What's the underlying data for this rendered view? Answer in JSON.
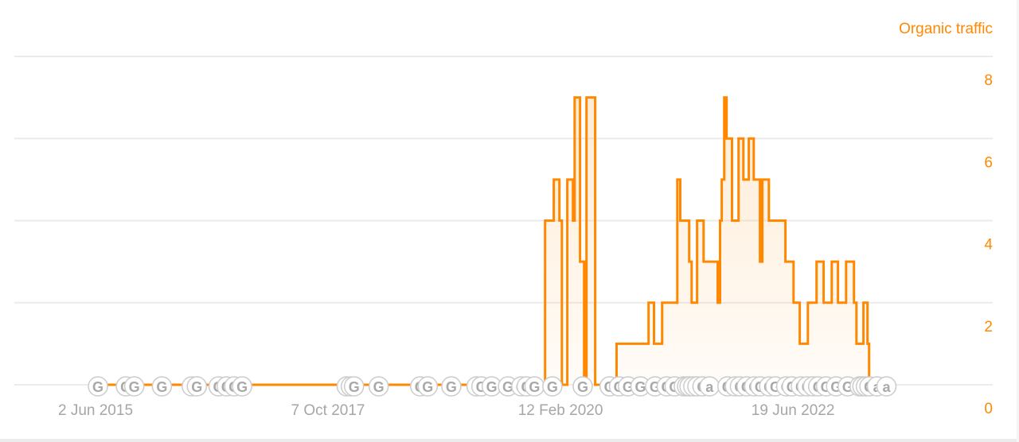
{
  "chart_data": {
    "type": "line",
    "step": true,
    "series": [
      {
        "name": "Organic traffic",
        "color": "#ff8800",
        "points": [
          [
            "2015-06-11",
            0
          ],
          [
            "2019-12-17",
            4
          ],
          [
            "2020-01-18",
            5
          ],
          [
            "2020-02-08",
            4
          ],
          [
            "2020-02-17",
            0
          ],
          [
            "2020-03-08",
            5
          ],
          [
            "2020-03-29",
            4
          ],
          [
            "2020-04-04",
            7
          ],
          [
            "2020-04-24",
            3
          ],
          [
            "2020-05-09",
            0
          ],
          [
            "2020-05-18",
            7
          ],
          [
            "2020-06-19",
            0
          ],
          [
            "2020-09-06",
            1
          ],
          [
            "2021-01-02",
            2
          ],
          [
            "2021-01-22",
            1
          ],
          [
            "2021-02-21",
            2
          ],
          [
            "2021-04-18",
            5
          ],
          [
            "2021-04-29",
            4
          ],
          [
            "2021-06-01",
            3
          ],
          [
            "2021-06-10",
            2
          ],
          [
            "2021-06-30",
            4
          ],
          [
            "2021-07-24",
            3
          ],
          [
            "2021-09-14",
            2
          ],
          [
            "2021-09-23",
            4
          ],
          [
            "2021-09-29",
            5
          ],
          [
            "2021-10-08",
            7
          ],
          [
            "2021-10-17",
            6
          ],
          [
            "2021-11-06",
            4
          ],
          [
            "2021-11-30",
            6
          ],
          [
            "2021-12-18",
            5
          ],
          [
            "2022-01-07",
            6
          ],
          [
            "2022-01-25",
            5
          ],
          [
            "2022-02-17",
            3
          ],
          [
            "2022-02-26",
            5
          ],
          [
            "2022-03-22",
            4
          ],
          [
            "2022-05-22",
            3
          ],
          [
            "2022-06-21",
            2
          ],
          [
            "2022-07-14",
            1
          ],
          [
            "2022-08-13",
            2
          ],
          [
            "2022-09-14",
            3
          ],
          [
            "2022-10-10",
            2
          ],
          [
            "2022-11-09",
            3
          ],
          [
            "2022-12-02",
            2
          ],
          [
            "2023-01-01",
            3
          ],
          [
            "2023-01-30",
            2
          ],
          [
            "2023-02-08",
            1
          ],
          [
            "2023-03-06",
            2
          ],
          [
            "2023-03-21",
            1
          ],
          [
            "2023-03-27",
            0
          ]
        ]
      }
    ],
    "title": "",
    "series_label": "Organic traffic",
    "xlabel": "",
    "ylabel": "",
    "x_tick_labels": [
      {
        "date": "2015-06-02",
        "label": "2 Jun 2015"
      },
      {
        "date": "2017-10-07",
        "label": "7 Oct 2017"
      },
      {
        "date": "2020-02-12",
        "label": "12 Feb 2020"
      },
      {
        "date": "2022-06-19",
        "label": "19 Jun 2022"
      }
    ],
    "y_ticks": [
      0,
      2,
      4,
      6,
      8
    ],
    "ylim": [
      0,
      8
    ],
    "xlim": [
      "2014-11-01",
      "2023-08-31"
    ],
    "y_axis_position": "right",
    "grid": true,
    "annotations": {
      "type": "google-update-markers",
      "markers": [
        {
          "date": "2015-06-11",
          "label": "G"
        },
        {
          "date": "2015-09-22",
          "label": "G"
        },
        {
          "date": "2015-10-23",
          "label": "G"
        },
        {
          "date": "2016-02-02",
          "label": "G"
        },
        {
          "date": "2016-05-22",
          "label": "G"
        },
        {
          "date": "2016-06-10",
          "label": "G"
        },
        {
          "date": "2016-08-29",
          "label": "G"
        },
        {
          "date": "2016-09-28",
          "label": "G"
        },
        {
          "date": "2016-10-26",
          "label": "G"
        },
        {
          "date": "2016-11-24",
          "label": "G"
        },
        {
          "date": "2017-12-15",
          "label": "G"
        },
        {
          "date": "2017-12-30",
          "label": "G"
        },
        {
          "date": "2018-01-11",
          "label": "G"
        },
        {
          "date": "2018-04-12",
          "label": "G"
        },
        {
          "date": "2018-09-12",
          "label": "G"
        },
        {
          "date": "2018-10-10",
          "label": "G"
        },
        {
          "date": "2019-01-05",
          "label": "G"
        },
        {
          "date": "2019-04-08",
          "label": "G"
        },
        {
          "date": "2019-04-26",
          "label": "G"
        },
        {
          "date": "2019-06-03",
          "label": "G"
        },
        {
          "date": "2019-08-02",
          "label": "G"
        },
        {
          "date": "2019-09-20",
          "label": "G"
        },
        {
          "date": "2019-10-10",
          "label": "G"
        },
        {
          "date": "2019-11-08",
          "label": "G"
        },
        {
          "date": "2020-01-13",
          "label": "G"
        },
        {
          "date": "2020-05-04",
          "label": "G"
        },
        {
          "date": "2020-08-11",
          "label": "G"
        },
        {
          "date": "2020-09-15",
          "label": "G"
        },
        {
          "date": "2020-10-18",
          "label": "G"
        },
        {
          "date": "2020-12-03",
          "label": "G"
        },
        {
          "date": "2021-01-26",
          "label": "G"
        },
        {
          "date": "2021-03-10",
          "label": "G"
        },
        {
          "date": "2021-04-08",
          "label": "G"
        },
        {
          "date": "2021-05-12",
          "label": "G"
        },
        {
          "date": "2021-05-24",
          "label": "G"
        },
        {
          "date": "2021-06-02",
          "label": "G"
        },
        {
          "date": "2021-06-16",
          "label": "G"
        },
        {
          "date": "2021-07-01",
          "label": "G"
        },
        {
          "date": "2021-07-20",
          "label": "G"
        },
        {
          "date": "2021-08-15",
          "label": "a"
        },
        {
          "date": "2021-10-20",
          "label": "G"
        },
        {
          "date": "2021-11-17",
          "label": "a"
        },
        {
          "date": "2021-12-05",
          "label": "G"
        },
        {
          "date": "2021-12-30",
          "label": "G"
        },
        {
          "date": "2022-01-27",
          "label": "G"
        },
        {
          "date": "2022-02-18",
          "label": "G"
        },
        {
          "date": "2022-03-23",
          "label": "G"
        },
        {
          "date": "2022-04-15",
          "label": "G"
        },
        {
          "date": "2022-05-25",
          "label": "G"
        },
        {
          "date": "2022-06-15",
          "label": "G"
        },
        {
          "date": "2022-07-18",
          "label": "G"
        },
        {
          "date": "2022-08-10",
          "label": "G"
        },
        {
          "date": "2022-09-01",
          "label": "G"
        },
        {
          "date": "2022-09-20",
          "label": "G"
        },
        {
          "date": "2022-10-19",
          "label": "G"
        },
        {
          "date": "2022-11-25",
          "label": "G"
        },
        {
          "date": "2023-01-07",
          "label": "G"
        },
        {
          "date": "2023-02-20",
          "label": "G"
        },
        {
          "date": "2023-03-02",
          "label": "G"
        },
        {
          "date": "2023-03-15",
          "label": "G"
        },
        {
          "date": "2023-03-28",
          "label": "G"
        },
        {
          "date": "2023-04-25",
          "label": "a"
        },
        {
          "date": "2023-05-30",
          "label": "a"
        }
      ]
    }
  }
}
